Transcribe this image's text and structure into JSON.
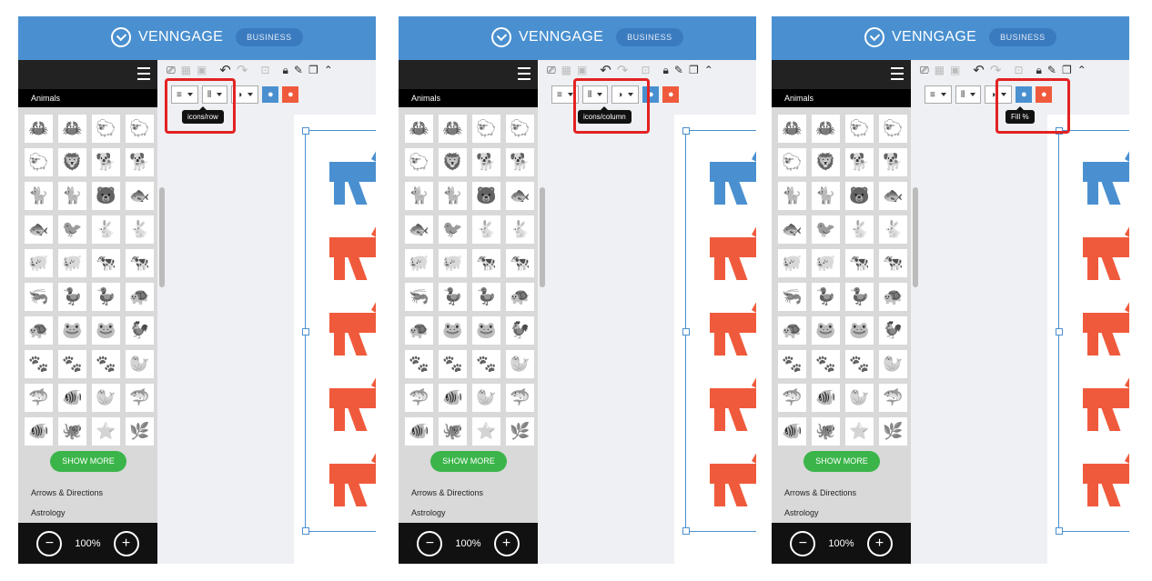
{
  "app": {
    "brand": "VENNGAGE",
    "plan_badge": "BUSINESS"
  },
  "sidebar": {
    "category": "Animals",
    "show_more": "SHOW MORE",
    "categories": [
      "Arrows & Directions",
      "Astrology"
    ],
    "zoom_level": "100%",
    "icon_rows": 10,
    "icon_cols": 4
  },
  "tooltips": [
    "icons/row",
    "icons/column",
    "Fill %"
  ],
  "colors": {
    "brand_blue": "#4a90d0",
    "accent_red": "#f05a3c",
    "button_green": "#3bb54a"
  },
  "toolbar": {
    "undo": "undo-icon",
    "redo": "redo-icon",
    "lock": "lock-icon"
  },
  "icons": [
    "crab",
    "crab-outline",
    "sheep",
    "sheep-outline",
    "sheep2",
    "lion",
    "dog",
    "dog-outline",
    "cat",
    "cat-outline",
    "bear",
    "fish",
    "fish-outline",
    "bird",
    "rabbit",
    "rabbit-outline",
    "pig",
    "pig-outline",
    "cow",
    "cow-outline",
    "shrimp",
    "duck",
    "duck-outline",
    "turtle",
    "turtle-outline",
    "frog",
    "frog-outline",
    "rooster",
    "paw",
    "paw-outline",
    "paw-bear",
    "seahorse",
    "shark",
    "clownfish",
    "seahorse-outline",
    "fin",
    "clownfish2",
    "octopus",
    "starfish",
    "coral"
  ]
}
